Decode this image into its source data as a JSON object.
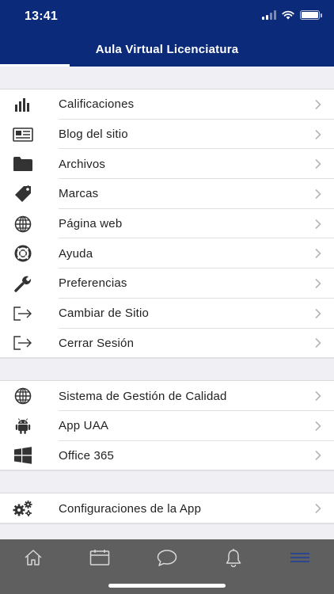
{
  "status_bar": {
    "time": "13:41"
  },
  "header": {
    "title": "Aula Virtual Licenciatura"
  },
  "sections": [
    {
      "items": [
        {
          "label": "Calificaciones",
          "icon": "bar-chart-icon"
        },
        {
          "label": "Blog del sitio",
          "icon": "newspaper-icon"
        },
        {
          "label": "Archivos",
          "icon": "folder-icon"
        },
        {
          "label": "Marcas",
          "icon": "tag-icon"
        },
        {
          "label": "Página web",
          "icon": "globe-icon"
        },
        {
          "label": "Ayuda",
          "icon": "lifebuoy-icon"
        },
        {
          "label": "Preferencias",
          "icon": "wrench-icon"
        },
        {
          "label": "Cambiar de Sitio",
          "icon": "sign-out-icon"
        },
        {
          "label": "Cerrar Sesión",
          "icon": "sign-out-icon"
        }
      ]
    },
    {
      "items": [
        {
          "label": "Sistema de Gestión de Calidad",
          "icon": "globe-icon"
        },
        {
          "label": "App UAA",
          "icon": "android-icon"
        },
        {
          "label": "Office 365",
          "icon": "windows-icon"
        }
      ]
    },
    {
      "items": [
        {
          "label": "Configuraciones de la App",
          "icon": "gears-icon"
        }
      ]
    }
  ],
  "tabbar": {
    "tabs": [
      {
        "icon": "home-icon"
      },
      {
        "icon": "calendar-icon"
      },
      {
        "icon": "chat-icon"
      },
      {
        "icon": "bell-icon"
      },
      {
        "icon": "menu-icon",
        "active": true
      }
    ],
    "active_color": "#1a3f9e",
    "inactive_color": "#d8d8d8"
  }
}
